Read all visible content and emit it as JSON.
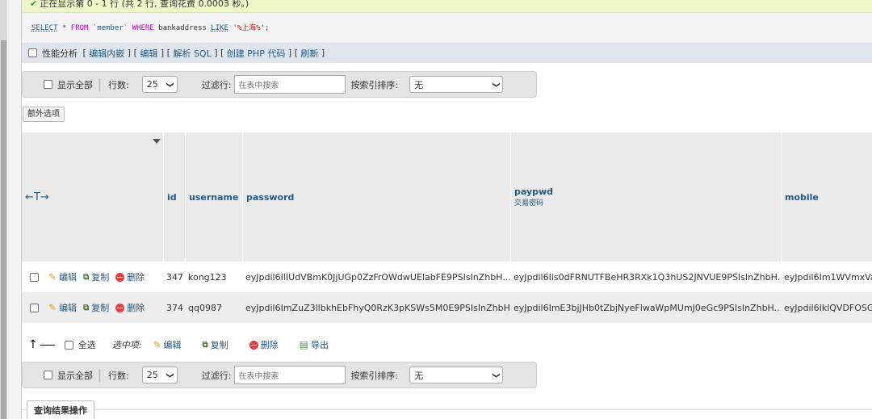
{
  "success_msg": "正在显示第 0 - 1 行 (共 2 行, 查询花费 0.0003 秒。)",
  "sql": {
    "select": "SELECT",
    "star_from": " * FROM ",
    "table": "`member`",
    "where": " WHERE ",
    "column": "bankaddress",
    "like": "LIKE",
    "pattern": "'%上海%'",
    "end": ";"
  },
  "profiling": {
    "label": "性能分析",
    "links": [
      "编辑内嵌",
      "编辑",
      "解析 SQL",
      "创建 PHP 代码",
      "刷新"
    ]
  },
  "nav": {
    "show_all": "显示全部",
    "rows_label": "行数:",
    "rows_value": "25",
    "filter_label": "过滤行:",
    "filter_placeholder": "在表中搜索",
    "sort_label": "按索引排序:",
    "sort_value": "无"
  },
  "extra_options": "额外选项",
  "table": {
    "nav_arrows": "←T→",
    "columns": [
      {
        "label": "id"
      },
      {
        "label": "username"
      },
      {
        "label": "password"
      },
      {
        "label": "paypwd",
        "sub": "交易密码"
      },
      {
        "label": "mobile"
      }
    ],
    "actions": {
      "edit": "编辑",
      "copy": "复制",
      "delete": "删除"
    },
    "rows": [
      {
        "id": "347",
        "username": "kong123",
        "password": "eyJpdil6IlIUdVBmK0JjUGp0ZzFrOWdwUElabFE9PSIsInZhbH...",
        "paypwd": "eyJpdil6Iis0dFRNUTFBeHR3RXk1Q3hUS2JNVUE9PSIsInZhbH...",
        "mobile": "eyJpdil6Im1WVmxVa"
      },
      {
        "id": "374",
        "username": "qq0987",
        "password": "eyJpdil6ImZuZ3llbkhEbFhyQ0RzK3pKSWs5M0E9PSIsInZhbH...",
        "paypwd": "eyJpdil6ImE3bjJHb0tZbjNyeFlwaWpMUmJ0eGc9PSIsInZhbH...",
        "mobile": "eyJpdil6IklQVDFOSG"
      }
    ]
  },
  "bulk": {
    "select_all": "全选",
    "with_selected": "选中项:",
    "edit": "编辑",
    "copy": "复制",
    "delete": "删除",
    "export": "导出"
  },
  "query_ops_tab": "查询结果操作"
}
